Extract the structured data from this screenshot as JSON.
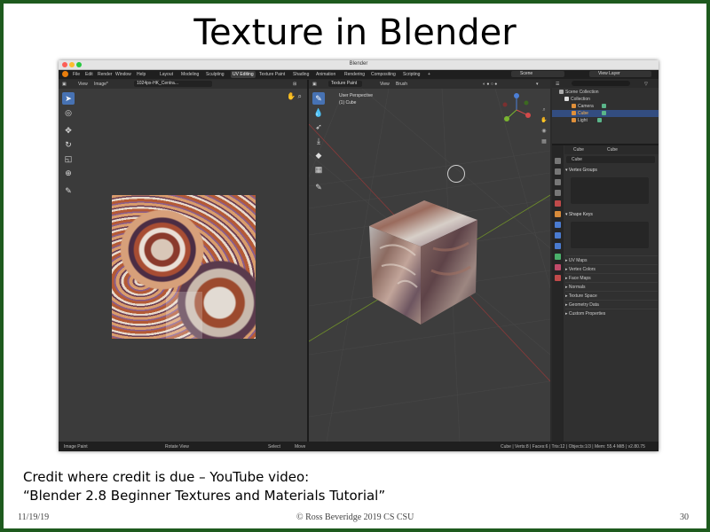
{
  "slide": {
    "title": "Texture in Blender",
    "credit_line1": "Credit where credit is due – YouTube video:",
    "credit_line2": "“Blender 2.8 Beginner Textures and Materials Tutorial”",
    "date": "11/19/19",
    "copyright": "© Ross Beveridge 2019 CS CSU",
    "page_number": "30"
  },
  "window": {
    "title": "Blender"
  },
  "menu": [
    "File",
    "Edit",
    "Render",
    "Window",
    "Help"
  ],
  "workspaces": [
    "Layout",
    "Modeling",
    "Sculpting",
    "UV Editing",
    "Texture Paint",
    "Shading",
    "Animation",
    "Rendering",
    "Compositing",
    "Scripting"
  ],
  "active_workspace": "UV Editing",
  "scene": "Scene",
  "view_layer": "View Layer",
  "uv_editor": {
    "view_menu": "View",
    "image_menu": "Image*",
    "image_name": "1024px-HK_Centra..."
  },
  "viewport": {
    "mode": "Texture Paint",
    "view_menu": "View",
    "brush_menu": "Brush",
    "info_line1": "User Perspective",
    "info_line2": "(1) Cube"
  },
  "outliner": {
    "root": "Scene Collection",
    "items": [
      {
        "label": "Collection"
      },
      {
        "label": "Camera"
      },
      {
        "label": "Cube"
      },
      {
        "label": "Light"
      }
    ]
  },
  "properties": {
    "object_tab": "Cube",
    "data_tab": "Cube",
    "object_name": "Cube",
    "vertex_groups": "Vertex Groups",
    "shape_keys": "Shape Keys",
    "panels": [
      "UV Maps",
      "Vertex Colors",
      "Face Maps",
      "Normals",
      "Texture Space",
      "Geometry Data",
      "Custom Properties"
    ]
  },
  "statusbar": {
    "left": "Image Paint",
    "middle": "Rotate View",
    "select": "Select",
    "move": "Move",
    "stats": "Cube | Verts:8 | Faces:6 | Tris:12 | Objects:1/3 | Mem: 55.4 MiB | v2.80.75"
  },
  "colors": {
    "accent": "#4772b3",
    "border": "#1e5a1e",
    "selection": "#334d80"
  },
  "icons": [
    "select-icon",
    "cursor-icon",
    "move-icon",
    "rotate-icon",
    "scale-icon",
    "transform-icon",
    "annotate-icon",
    "brush-icon",
    "hand-icon",
    "zoom-icon",
    "eye-icon"
  ]
}
